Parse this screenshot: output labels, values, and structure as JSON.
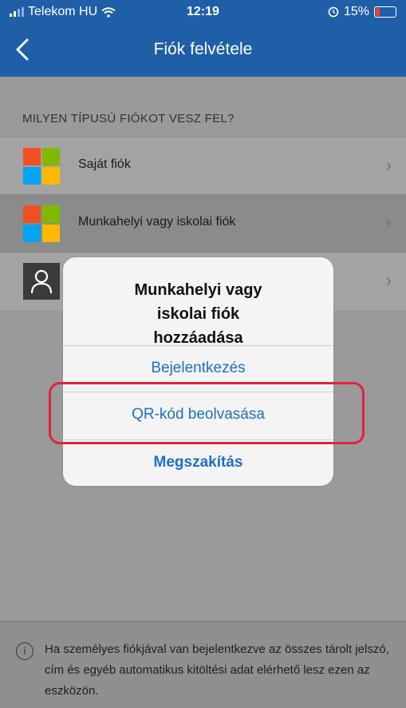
{
  "status": {
    "carrier": "Telekom HU",
    "time": "12:19",
    "battery": "15%",
    "icons": [
      "signal-icon",
      "wifi-icon",
      "alarm-icon",
      "battery-icon"
    ]
  },
  "nav": {
    "back_icon": "chevron-left-icon",
    "title": "Fiók felvétele"
  },
  "section_header": "MILYEN TÍPUSÚ FIÓKOT VESZ FEL?",
  "accounts": [
    {
      "label": "Saját fiók",
      "icon": "microsoft-logo-icon"
    },
    {
      "label": "Munkahelyi vagy iskolai fiók",
      "icon": "microsoft-logo-icon"
    },
    {
      "label": "",
      "icon": "person-icon"
    }
  ],
  "alert": {
    "title": "Munkahelyi vagy iskolai fiók hozzáadása",
    "buttons": {
      "sign_in": "Bejelentkezés",
      "scan_qr": "QR-kód beolvasása",
      "cancel": "Megszakítás"
    }
  },
  "footer": {
    "text": "Ha személyes fiókjával van bejelentkezve az összes tárolt jelszó, cím és egyéb automatikus kitöltési adat elérhető lesz ezen az eszközön.",
    "icon": "info-icon"
  },
  "colors": {
    "nav_blue": "#1f5fa8",
    "link_blue": "#1d6fc9",
    "highlight_red": "#e0243a",
    "ms_red": "#f25022",
    "ms_green": "#7fba00",
    "ms_blue": "#00a4ef",
    "ms_yellow": "#ffb900"
  }
}
